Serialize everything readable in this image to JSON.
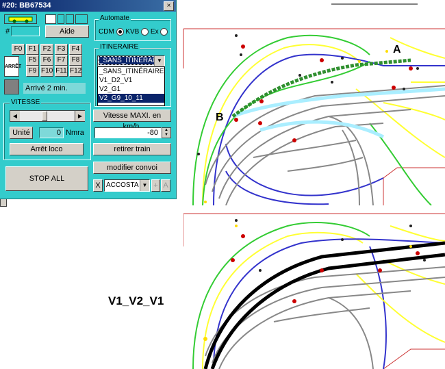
{
  "window": {
    "title": "#20: BB67534",
    "close_label": "×",
    "hash_label": "#",
    "aide_label": "Aide",
    "arret_icon_text": "ARRÊT",
    "arrival_text": "Arrivé  2 min.",
    "function_buttons": [
      "F0",
      "F1",
      "F2",
      "F3",
      "F4",
      "F5",
      "F6",
      "F7",
      "F8",
      "F9",
      "F10",
      "F11",
      "F12"
    ]
  },
  "automate": {
    "label": "Automate",
    "options": [
      "CDM",
      "KVB",
      "Ex"
    ],
    "selected": "CDM"
  },
  "itineraire": {
    "label": "ITINERAIRE",
    "current_value": "_SANS_ITINÉRAIRE",
    "options": [
      "_SANS_ITINÉRAIRE",
      "V1_D2_V1",
      "V2_G1",
      "V2_G9_10_11"
    ],
    "selected_index": 3
  },
  "vitesse": {
    "label": "VITESSE",
    "unit_button": "Unité",
    "value": "0",
    "nmra_label": "Nmra",
    "stop_loco_button": "Arrêt loco",
    "stop_all_button": "STOP ALL",
    "slider_level": 0.45
  },
  "right_controls": {
    "vmax_button": "Vitesse MAXI. en km/h.",
    "vmax_value": "-80",
    "remove_train_button": "retirer train",
    "modify_convoy_button": "modifier convoi",
    "x_label": "X",
    "accosta_value": "ACCOSTA",
    "plus_label": "+",
    "a_label": "A"
  },
  "map_labels": {
    "top_a": "A",
    "top_b": "B",
    "bottom_caption": "V1_V2_V1"
  },
  "colors": {
    "window_bg": "#33cccc",
    "track_green": "#33cc33",
    "track_blue": "#3333cc",
    "track_yellow": "#ffff33",
    "track_grey": "#888888",
    "route_black": "#000000",
    "border_red": "#cc3333"
  }
}
